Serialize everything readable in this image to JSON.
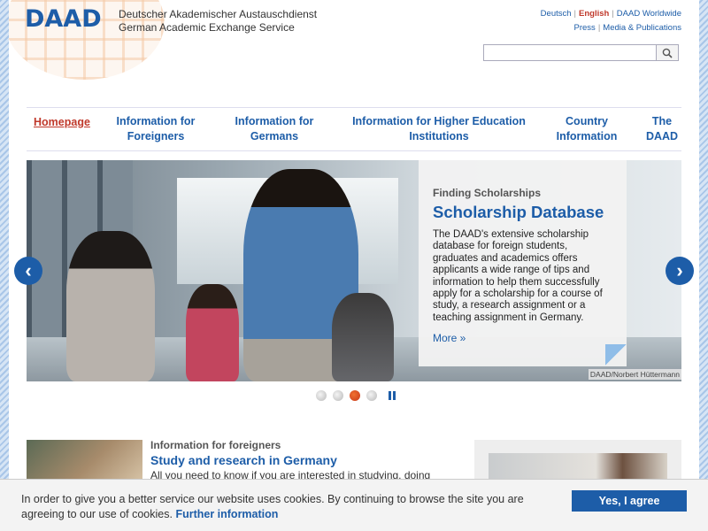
{
  "header": {
    "logo": "DAAD",
    "org_line1": "Deutscher Akademischer Austauschdienst",
    "org_line2": "German Academic Exchange Service",
    "top_links_row1": [
      "Deutsch",
      "English",
      "DAAD Worldwide"
    ],
    "top_links_row2": [
      "Press",
      "Media & Publications"
    ],
    "search_placeholder": ""
  },
  "nav": {
    "items": [
      {
        "label": "Homepage"
      },
      {
        "label": "Information for Foreigners"
      },
      {
        "label": "Information for Germans"
      },
      {
        "label": "Information for Higher Education Institutions"
      },
      {
        "label": "Country Information"
      },
      {
        "label": "The DAAD"
      }
    ]
  },
  "slider": {
    "kicker": "Finding Scholarships",
    "title": "Scholarship Database",
    "text": "The DAAD's extensive scholarship database for foreign students, graduates and academics offers applicants a wide range of tips and information to help them successfully apply for a scholarship for a course of study, a research assignment or a teaching assignment in Germany.",
    "more": "More »",
    "credit": "DAAD/Norbert Hüttermann",
    "prev": "‹",
    "next": "›",
    "active_slide": 3,
    "slide_count": 4
  },
  "teaser": {
    "kicker": "Information for foreigners",
    "title": "Study and research in Germany",
    "text": "All you need to know if you are interested in studying, doing"
  },
  "cookie": {
    "message": "In order to give you a better service our website uses cookies. By continuing to browse the site you are agreeing to our use of cookies.",
    "link": "Further information",
    "agree": "Yes, I agree"
  },
  "colors": {
    "brand_blue": "#1d5da8",
    "active_red": "#c0392b"
  }
}
